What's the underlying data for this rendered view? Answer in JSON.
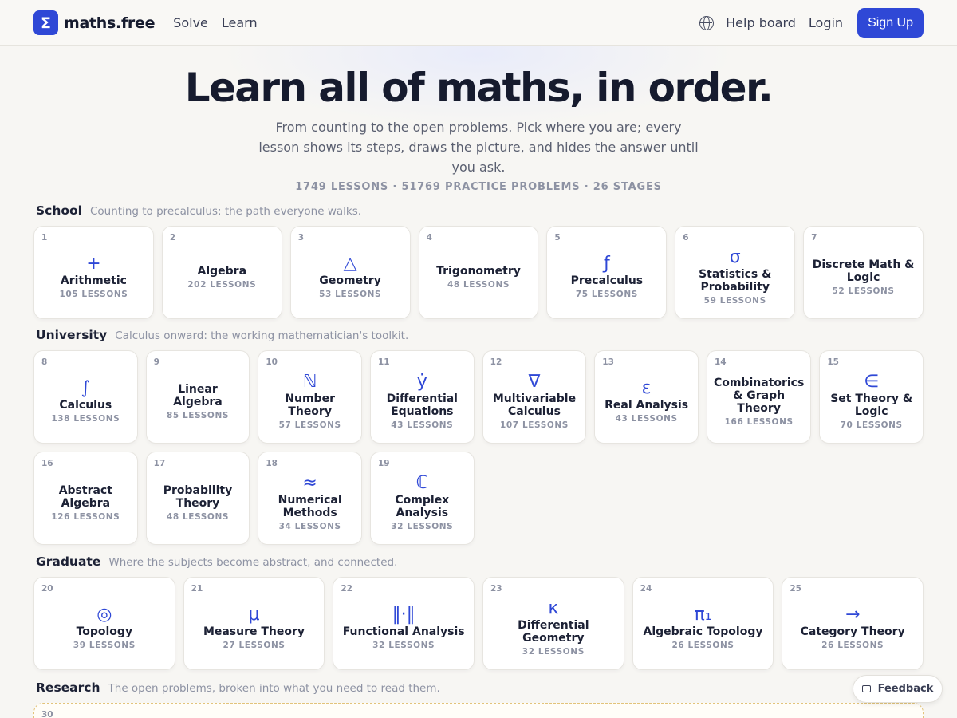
{
  "header": {
    "logo_symbol": "Σ",
    "logo_text": "maths.free",
    "nav": [
      "Solve",
      "Learn"
    ],
    "help": "Help board",
    "login": "Login",
    "signup": "Sign Up"
  },
  "hero": {
    "title": "Learn all of maths, in order.",
    "subtitle": "From counting to the open problems. Pick where you are; every lesson shows its steps, draws the picture, and hides the answer until you ask.",
    "stats": "1749 LESSONS · 51769 PRACTICE PROBLEMS · 26 STAGES"
  },
  "sections": {
    "school": {
      "title": "School",
      "desc": "Counting to precalculus: the path everyone walks.",
      "cards": [
        {
          "num": "1",
          "icon": "+",
          "title": "Arithmetic",
          "count": "105 LESSONS"
        },
        {
          "num": "2",
          "icon": "",
          "title": "Algebra",
          "count": "202 LESSONS"
        },
        {
          "num": "3",
          "icon": "△",
          "title": "Geometry",
          "count": "53 LESSONS"
        },
        {
          "num": "4",
          "icon": "",
          "title": "Trigonometry",
          "count": "48 LESSONS"
        },
        {
          "num": "5",
          "icon": "ƒ",
          "title": "Precalculus",
          "count": "75 LESSONS"
        },
        {
          "num": "6",
          "icon": "σ",
          "title": "Statistics & Probability",
          "count": "59 LESSONS"
        },
        {
          "num": "7",
          "icon": "",
          "title": "Discrete Math & Logic",
          "count": "52 LESSONS"
        }
      ]
    },
    "university": {
      "title": "University",
      "desc": "Calculus onward: the working mathematician's toolkit.",
      "cards": [
        {
          "num": "8",
          "icon": "∫",
          "title": "Calculus",
          "count": "138 LESSONS"
        },
        {
          "num": "9",
          "icon": "",
          "title": "Linear Algebra",
          "count": "85 LESSONS"
        },
        {
          "num": "10",
          "icon": "ℕ",
          "title": "Number Theory",
          "count": "57 LESSONS"
        },
        {
          "num": "11",
          "icon": "ẏ",
          "title": "Differential Equations",
          "count": "43 LESSONS"
        },
        {
          "num": "12",
          "icon": "∇",
          "title": "Multivariable Calculus",
          "count": "107 LESSONS"
        },
        {
          "num": "13",
          "icon": "ε",
          "title": "Real Analysis",
          "count": "43 LESSONS"
        },
        {
          "num": "14",
          "icon": "",
          "title": "Combinatorics & Graph Theory",
          "count": "166 LESSONS"
        },
        {
          "num": "15",
          "icon": "∈",
          "title": "Set Theory & Logic",
          "count": "70 LESSONS"
        },
        {
          "num": "16",
          "icon": "",
          "title": "Abstract Algebra",
          "count": "126 LESSONS"
        },
        {
          "num": "17",
          "icon": "",
          "title": "Probability Theory",
          "count": "48 LESSONS"
        },
        {
          "num": "18",
          "icon": "≈",
          "title": "Numerical Methods",
          "count": "34 LESSONS"
        },
        {
          "num": "19",
          "icon": "ℂ",
          "title": "Complex Analysis",
          "count": "32 LESSONS"
        }
      ]
    },
    "graduate": {
      "title": "Graduate",
      "desc": "Where the subjects become abstract, and connected.",
      "cards": [
        {
          "num": "20",
          "icon": "◎",
          "title": "Topology",
          "count": "39 LESSONS"
        },
        {
          "num": "21",
          "icon": "μ",
          "title": "Measure Theory",
          "count": "27 LESSONS"
        },
        {
          "num": "22",
          "icon": "‖·‖",
          "title": "Functional Analysis",
          "count": "32 LESSONS"
        },
        {
          "num": "23",
          "icon": "κ",
          "title": "Differential Geometry",
          "count": "32 LESSONS"
        },
        {
          "num": "24",
          "icon": "π₁",
          "title": "Algebraic Topology",
          "count": "26 LESSONS"
        },
        {
          "num": "25",
          "icon": "→",
          "title": "Category Theory",
          "count": "26 LESSONS"
        }
      ]
    },
    "research": {
      "title": "Research",
      "desc": "The open problems, broken into what you need to read them.",
      "num": "30",
      "icon": "∞"
    }
  },
  "feedback": "Feedback"
}
